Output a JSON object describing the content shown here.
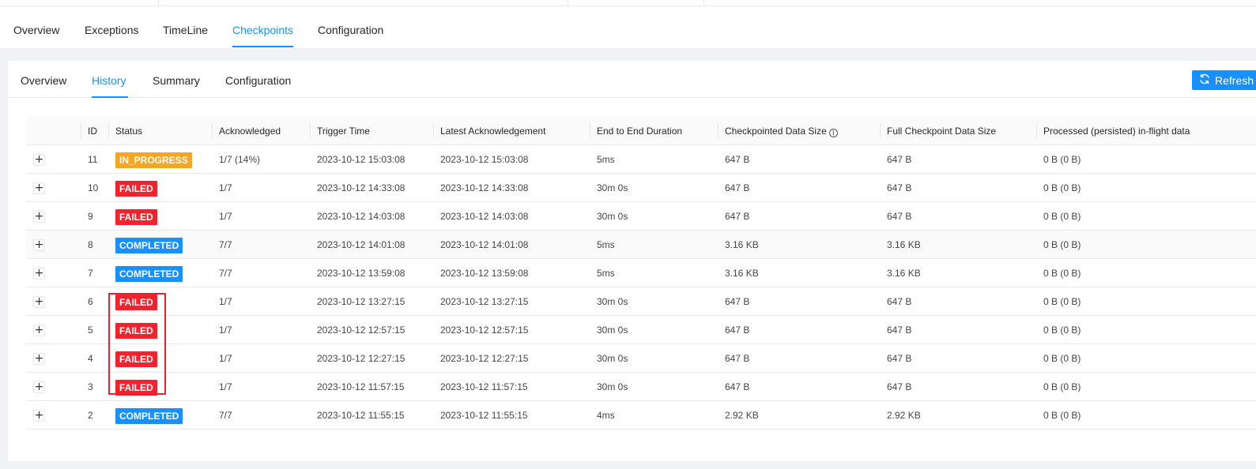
{
  "main_tabs": {
    "active": "Checkpoints",
    "items": [
      {
        "label": "Overview"
      },
      {
        "label": "Exceptions"
      },
      {
        "label": "TimeLine"
      },
      {
        "label": "Checkpoints"
      },
      {
        "label": "Configuration"
      }
    ]
  },
  "sub_tabs": {
    "active": "History",
    "items": [
      {
        "label": "Overview"
      },
      {
        "label": "History"
      },
      {
        "label": "Summary"
      },
      {
        "label": "Configuration"
      }
    ]
  },
  "refresh_button": {
    "label": "Refresh",
    "icon": "sync-icon"
  },
  "table": {
    "columns": [
      "ID",
      "Status",
      "Acknowledged",
      "Trigger Time",
      "Latest Acknowledgement",
      "End to End Duration",
      "Checkpointed Data Size",
      "Full Checkpoint Data Size",
      "Processed (persisted) in-flight data"
    ],
    "info_icon": "i",
    "rows": [
      {
        "expand": "+",
        "id": "11",
        "status": "IN_PROGRESS",
        "acknowledged": "1/7 (14%)",
        "trigger_time": "2023-10-12 15:03:08",
        "latest_ack": "2023-10-12 15:03:08",
        "duration": "5ms",
        "checkpointed_size": "647 B",
        "full_size": "647 B",
        "processed": "0 B (0 B)"
      },
      {
        "expand": "+",
        "id": "10",
        "status": "FAILED",
        "acknowledged": "1/7",
        "trigger_time": "2023-10-12 14:33:08",
        "latest_ack": "2023-10-12 14:33:08",
        "duration": "30m 0s",
        "checkpointed_size": "647 B",
        "full_size": "647 B",
        "processed": "0 B (0 B)"
      },
      {
        "expand": "+",
        "id": "9",
        "status": "FAILED",
        "acknowledged": "1/7",
        "trigger_time": "2023-10-12 14:03:08",
        "latest_ack": "2023-10-12 14:03:08",
        "duration": "30m 0s",
        "checkpointed_size": "647 B",
        "full_size": "647 B",
        "processed": "0 B (0 B)"
      },
      {
        "expand": "+",
        "id": "8",
        "status": "COMPLETED",
        "acknowledged": "7/7",
        "trigger_time": "2023-10-12 14:01:08",
        "latest_ack": "2023-10-12 14:01:08",
        "duration": "5ms",
        "checkpointed_size": "3.16 KB",
        "full_size": "3.16 KB",
        "processed": "0 B (0 B)"
      },
      {
        "expand": "+",
        "id": "7",
        "status": "COMPLETED",
        "acknowledged": "7/7",
        "trigger_time": "2023-10-12 13:59:08",
        "latest_ack": "2023-10-12 13:59:08",
        "duration": "5ms",
        "checkpointed_size": "3.16 KB",
        "full_size": "3.16 KB",
        "processed": "0 B (0 B)"
      },
      {
        "expand": "+",
        "id": "6",
        "status": "FAILED",
        "acknowledged": "1/7",
        "trigger_time": "2023-10-12 13:27:15",
        "latest_ack": "2023-10-12 13:27:15",
        "duration": "30m 0s",
        "checkpointed_size": "647 B",
        "full_size": "647 B",
        "processed": "0 B (0 B)"
      },
      {
        "expand": "+",
        "id": "5",
        "status": "FAILED",
        "acknowledged": "1/7",
        "trigger_time": "2023-10-12 12:57:15",
        "latest_ack": "2023-10-12 12:57:15",
        "duration": "30m 0s",
        "checkpointed_size": "647 B",
        "full_size": "647 B",
        "processed": "0 B (0 B)"
      },
      {
        "expand": "+",
        "id": "4",
        "status": "FAILED",
        "acknowledged": "1/7",
        "trigger_time": "2023-10-12 12:27:15",
        "latest_ack": "2023-10-12 12:27:15",
        "duration": "30m 0s",
        "checkpointed_size": "647 B",
        "full_size": "647 B",
        "processed": "0 B (0 B)"
      },
      {
        "expand": "+",
        "id": "3",
        "status": "FAILED",
        "acknowledged": "1/7",
        "trigger_time": "2023-10-12 11:57:15",
        "latest_ack": "2023-10-12 11:57:15",
        "duration": "30m 0s",
        "checkpointed_size": "647 B",
        "full_size": "647 B",
        "processed": "0 B (0 B)"
      },
      {
        "expand": "+",
        "id": "2",
        "status": "COMPLETED",
        "acknowledged": "7/7",
        "trigger_time": "2023-10-12 11:55:15",
        "latest_ack": "2023-10-12 11:55:15",
        "duration": "4ms",
        "checkpointed_size": "2.92 KB",
        "full_size": "2.92 KB",
        "processed": "0 B (0 B)"
      }
    ]
  },
  "status_colors": {
    "IN_PROGRESS": "#f5a623",
    "FAILED": "#f5222d",
    "COMPLETED": "#1890ff"
  },
  "colors": {
    "accent": "#1890ff",
    "annotation_box": "#e8212e"
  }
}
